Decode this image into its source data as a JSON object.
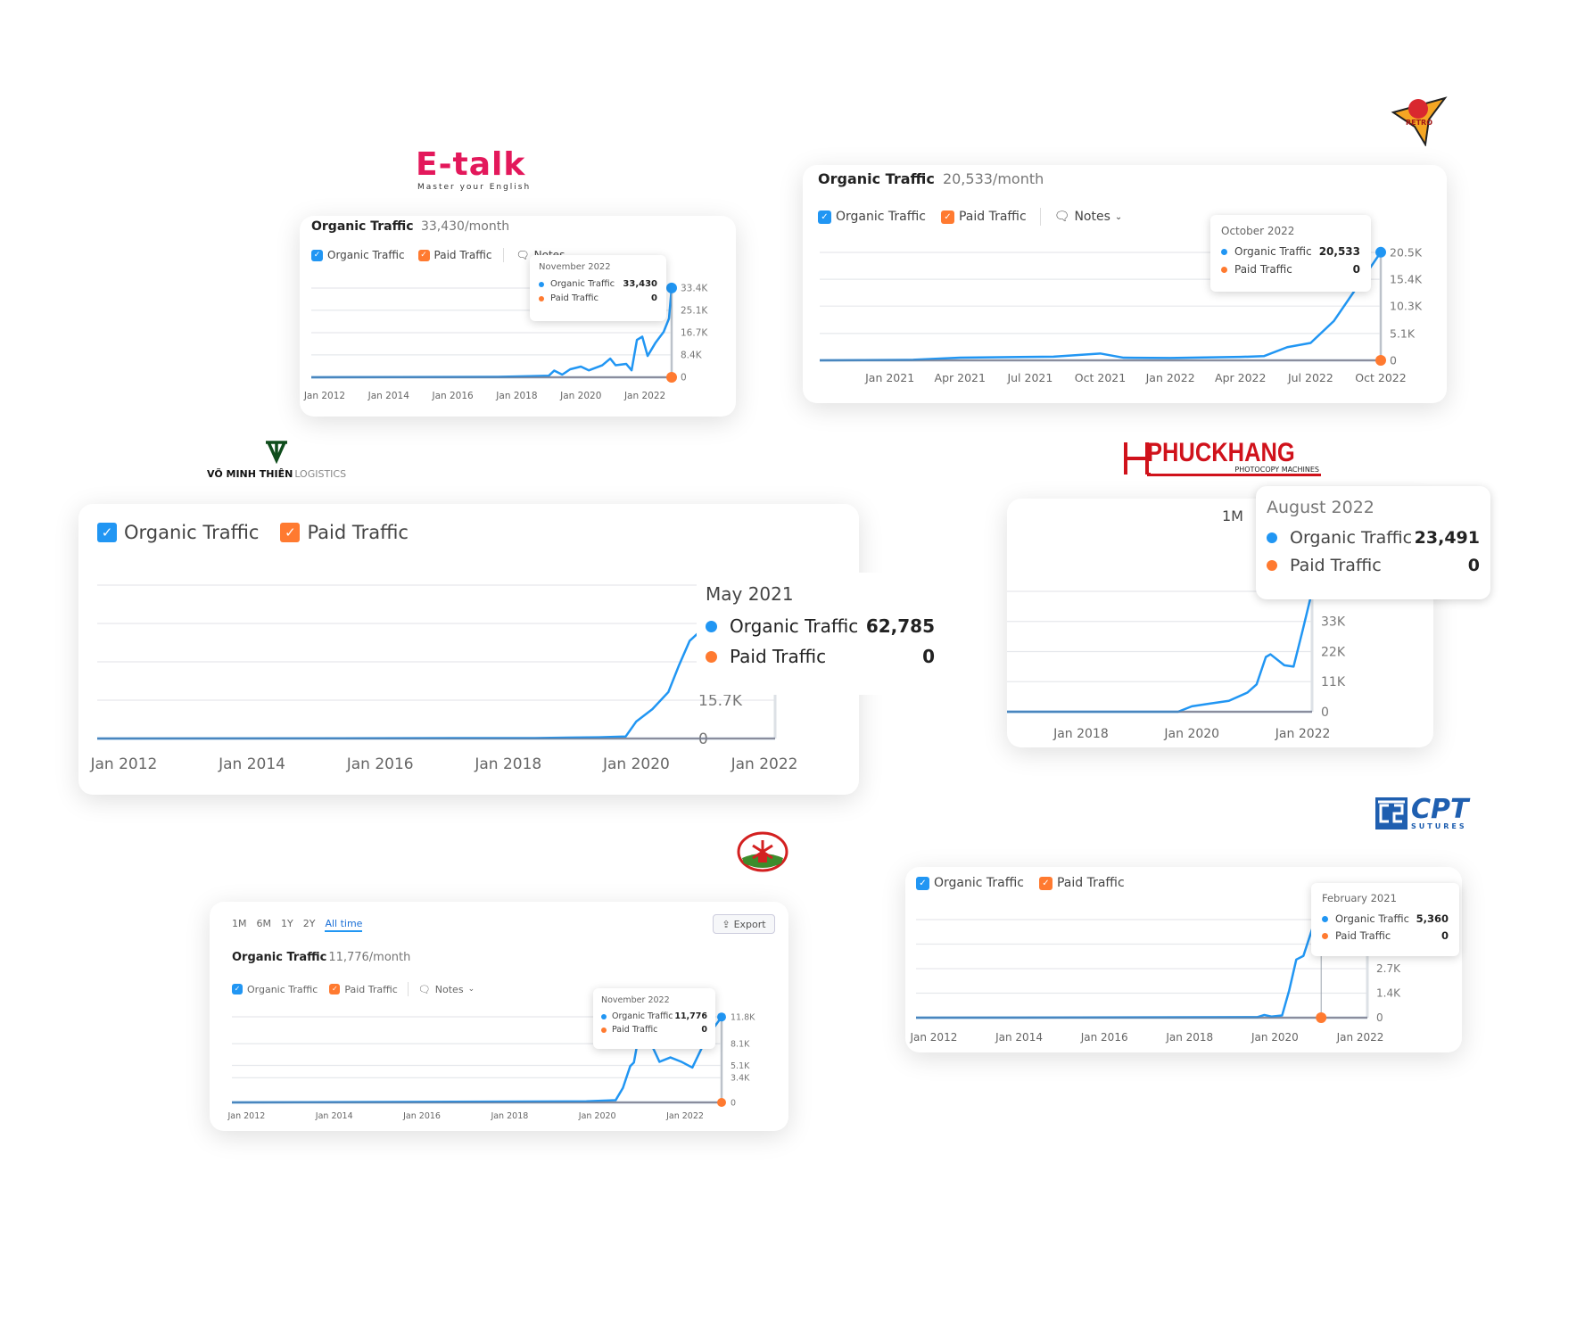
{
  "logos": {
    "etalk": {
      "name": "E-talk",
      "tagline": "Master your English"
    },
    "saigon_retro": {
      "name": "SAIGON RETRO"
    },
    "vmt": {
      "name": "VÕ MINH THIÊN",
      "suffix": "LOGISTICS"
    },
    "phuckhang": {
      "name": "PHUCKHANG",
      "tagline": "PHOTOCOPY MACHINES"
    },
    "windmill": {
      "name": "windmill-logo"
    },
    "cpt": {
      "name": "CPT",
      "tagline": "SUTURES"
    }
  },
  "colors": {
    "organic": "#2196f3",
    "paid": "#ff7a30",
    "grid": "#e6e8ec"
  },
  "legend": {
    "organic": "Organic Traffic",
    "paid": "Paid Traffic",
    "notes": "Notes",
    "check": "✓"
  },
  "cards": [
    {
      "title": "Organic Traffic",
      "subtitle": "33,430/month",
      "tooltip": {
        "date": "November 2022",
        "organic": "33,430",
        "paid": "0"
      }
    },
    {
      "title": "Organic Traffic",
      "subtitle": "20,533/month",
      "tooltip": {
        "date": "October 2022",
        "organic": "20,533",
        "paid": "0"
      }
    },
    {
      "tooltip": {
        "date": "May 2021",
        "organic": "62,785",
        "paid": "0"
      }
    },
    {
      "range": "1M",
      "tooltip": {
        "date": "August 2022",
        "organic": "23,491",
        "paid": "0"
      }
    },
    {
      "title": "Organic Traffic",
      "subtitle": "11,776/month",
      "ranges": [
        "1M",
        "6M",
        "1Y",
        "2Y",
        "All time"
      ],
      "active_range": "All time",
      "export": "Export",
      "tooltip": {
        "date": "November 2022",
        "organic": "11,776",
        "paid": "0"
      }
    },
    {
      "tooltip": {
        "date": "February 2021",
        "organic": "5,360",
        "paid": "0"
      }
    }
  ],
  "chart_data": [
    {
      "type": "line",
      "x_range": [
        "2011-08",
        "2022-11"
      ],
      "ylim": [
        0,
        33400
      ],
      "x_ticks": [
        {
          "label": "Jan 2012",
          "date": "2012-01"
        },
        {
          "label": "Jan 2014",
          "date": "2014-01"
        },
        {
          "label": "Jan 2016",
          "date": "2016-01"
        },
        {
          "label": "Jan 2018",
          "date": "2018-01"
        },
        {
          "label": "Jan 2020",
          "date": "2020-01"
        },
        {
          "label": "Jan 2022",
          "date": "2022-01"
        }
      ],
      "y_ticks": [
        {
          "label": "0",
          "value": 0
        },
        {
          "label": "8.4K",
          "value": 8400
        },
        {
          "label": "16.7K",
          "value": 16700
        },
        {
          "label": "25.1K",
          "value": 25100
        },
        {
          "label": "33.4K",
          "value": 33400
        }
      ],
      "hover": "2022-11",
      "series": [
        {
          "name": "Organic Traffic",
          "points": [
            [
              "2011-08",
              0
            ],
            [
              "2017-06",
              150
            ],
            [
              "2018-06",
              400
            ],
            [
              "2019-01",
              600
            ],
            [
              "2019-03",
              2500
            ],
            [
              "2019-06",
              1000
            ],
            [
              "2019-09",
              3000
            ],
            [
              "2020-01",
              4000
            ],
            [
              "2020-04",
              2600
            ],
            [
              "2020-09",
              4500
            ],
            [
              "2020-12",
              7000
            ],
            [
              "2021-02",
              4500
            ],
            [
              "2021-06",
              5000
            ],
            [
              "2021-08",
              2600
            ],
            [
              "2021-10",
              14000
            ],
            [
              "2021-12",
              15200
            ],
            [
              "2022-02",
              8000
            ],
            [
              "2022-05",
              13000
            ],
            [
              "2022-08",
              17000
            ],
            [
              "2022-10",
              22000
            ],
            [
              "2022-11",
              33430
            ]
          ]
        },
        {
          "name": "Paid Traffic",
          "points": [
            [
              "2011-08",
              0
            ],
            [
              "2022-11",
              0
            ]
          ]
        }
      ]
    },
    {
      "type": "line",
      "x_range": [
        "2020-10",
        "2022-10"
      ],
      "ylim": [
        0,
        20500
      ],
      "x_ticks": [
        {
          "label": "Jan 2021",
          "date": "2021-01"
        },
        {
          "label": "Apr 2021",
          "date": "2021-04"
        },
        {
          "label": "Jul 2021",
          "date": "2021-07"
        },
        {
          "label": "Oct 2021",
          "date": "2021-10"
        },
        {
          "label": "Jan 2022",
          "date": "2022-01"
        },
        {
          "label": "Apr 2022",
          "date": "2022-04"
        },
        {
          "label": "Jul 2022",
          "date": "2022-07"
        },
        {
          "label": "Oct 2022",
          "date": "2022-10"
        }
      ],
      "y_ticks": [
        {
          "label": "0",
          "value": 0
        },
        {
          "label": "5.1K",
          "value": 5100
        },
        {
          "label": "10.3K",
          "value": 10300
        },
        {
          "label": "15.4K",
          "value": 15400
        },
        {
          "label": "20.5K",
          "value": 20500
        }
      ],
      "hover": "2022-10",
      "series": [
        {
          "name": "Organic Traffic",
          "points": [
            [
              "2020-10",
              0
            ],
            [
              "2021-02",
              100
            ],
            [
              "2021-04",
              500
            ],
            [
              "2021-08",
              700
            ],
            [
              "2021-10",
              1300
            ],
            [
              "2021-11",
              500
            ],
            [
              "2022-01",
              450
            ],
            [
              "2022-04",
              650
            ],
            [
              "2022-05",
              800
            ],
            [
              "2022-06",
              2500
            ],
            [
              "2022-07",
              3300
            ],
            [
              "2022-08",
              7500
            ],
            [
              "2022-09",
              14000
            ],
            [
              "2022-10",
              20533
            ]
          ]
        },
        {
          "name": "Paid Traffic",
          "points": [
            [
              "2020-10",
              0
            ],
            [
              "2022-10",
              0
            ]
          ]
        }
      ]
    },
    {
      "type": "line",
      "x_range": [
        "2011-08",
        "2022-03"
      ],
      "ylim": [
        0,
        62785
      ],
      "x_ticks": [
        {
          "label": "Jan 2012",
          "date": "2012-01"
        },
        {
          "label": "Jan 2014",
          "date": "2014-01"
        },
        {
          "label": "Jan 2016",
          "date": "2016-01"
        },
        {
          "label": "Jan 2018",
          "date": "2018-01"
        },
        {
          "label": "Jan 2020",
          "date": "2020-01"
        },
        {
          "label": "Jan 2022",
          "date": "2022-01"
        }
      ],
      "y_ticks": [
        {
          "label": "0",
          "value": 0
        },
        {
          "label": "15.7K",
          "value": 15700
        },
        {
          "label": "",
          "value": 31400
        },
        {
          "label": "",
          "value": 47100
        },
        {
          "label": "",
          "value": 62785
        }
      ],
      "hover": "2021-05",
      "series": [
        {
          "name": "Organic Traffic",
          "points": [
            [
              "2011-08",
              0
            ],
            [
              "2018-06",
              200
            ],
            [
              "2019-06",
              500
            ],
            [
              "2019-11",
              800
            ],
            [
              "2020-01",
              7000
            ],
            [
              "2020-04",
              12000
            ],
            [
              "2020-07",
              19000
            ],
            [
              "2020-09",
              30000
            ],
            [
              "2020-11",
              40000
            ],
            [
              "2021-01",
              44000
            ],
            [
              "2021-02",
              34000
            ],
            [
              "2021-03",
              47000
            ],
            [
              "2021-04",
              40000
            ],
            [
              "2021-05",
              62785
            ]
          ]
        },
        {
          "name": "Paid Traffic",
          "points": [
            [
              "2011-08",
              0
            ],
            [
              "2022-03",
              0
            ]
          ]
        }
      ]
    },
    {
      "type": "line",
      "x_range": [
        "2016-09",
        "2022-03"
      ],
      "ylim": [
        0,
        44000
      ],
      "x_ticks": [
        {
          "label": "Jan 2018",
          "date": "2018-01"
        },
        {
          "label": "Jan 2020",
          "date": "2020-01"
        },
        {
          "label": "Jan 2022",
          "date": "2022-01"
        }
      ],
      "y_ticks": [
        {
          "label": "0",
          "value": 0
        },
        {
          "label": "11K",
          "value": 11000
        },
        {
          "label": "22K",
          "value": 22000
        },
        {
          "label": "33K",
          "value": 33000
        },
        {
          "label": "",
          "value": 44000
        }
      ],
      "hover": null,
      "series": [
        {
          "name": "Organic Traffic",
          "points": [
            [
              "2016-09",
              0
            ],
            [
              "2019-10",
              0
            ],
            [
              "2020-01",
              2000
            ],
            [
              "2020-05",
              3000
            ],
            [
              "2020-09",
              4000
            ],
            [
              "2021-01",
              7000
            ],
            [
              "2021-03",
              10000
            ],
            [
              "2021-05",
              20000
            ],
            [
              "2021-06",
              21000
            ],
            [
              "2021-09",
              17000
            ],
            [
              "2021-11",
              16500
            ],
            [
              "2022-01",
              30000
            ],
            [
              "2022-03",
              44000
            ]
          ]
        },
        {
          "name": "Paid Traffic",
          "points": [
            [
              "2016-09",
              0
            ],
            [
              "2022-03",
              0
            ]
          ]
        }
      ]
    },
    {
      "type": "line",
      "x_range": [
        "2011-09",
        "2022-11"
      ],
      "ylim": [
        0,
        11800
      ],
      "x_ticks": [
        {
          "label": "Jan 2012",
          "date": "2012-01"
        },
        {
          "label": "Jan 2014",
          "date": "2014-01"
        },
        {
          "label": "Jan 2016",
          "date": "2016-01"
        },
        {
          "label": "Jan 2018",
          "date": "2018-01"
        },
        {
          "label": "Jan 2020",
          "date": "2020-01"
        },
        {
          "label": "Jan 2022",
          "date": "2022-01"
        }
      ],
      "y_ticks": [
        {
          "label": "0",
          "value": 0
        },
        {
          "label": "3.4K",
          "value": 3400
        },
        {
          "label": "5.1K",
          "value": 5100
        },
        {
          "label": "8.1K",
          "value": 8100
        },
        {
          "label": "11.8K",
          "value": 11800
        }
      ],
      "hover": "2022-11",
      "series": [
        {
          "name": "Organic Traffic",
          "points": [
            [
              "2011-09",
              0
            ],
            [
              "2019-10",
              150
            ],
            [
              "2020-06",
              300
            ],
            [
              "2020-08",
              2000
            ],
            [
              "2020-10",
              5000
            ],
            [
              "2020-11",
              5500
            ],
            [
              "2021-01",
              11000
            ],
            [
              "2021-06",
              5600
            ],
            [
              "2021-09",
              6200
            ],
            [
              "2021-12",
              5600
            ],
            [
              "2022-03",
              4800
            ],
            [
              "2022-07",
              9000
            ],
            [
              "2022-11",
              11776
            ]
          ]
        },
        {
          "name": "Paid Traffic",
          "points": [
            [
              "2011-09",
              0
            ],
            [
              "2022-11",
              0
            ]
          ]
        }
      ]
    },
    {
      "type": "line",
      "x_range": [
        "2011-08",
        "2022-03"
      ],
      "ylim": [
        0,
        5400
      ],
      "x_ticks": [
        {
          "label": "Jan 2012",
          "date": "2012-01"
        },
        {
          "label": "Jan 2014",
          "date": "2014-01"
        },
        {
          "label": "Jan 2016",
          "date": "2016-01"
        },
        {
          "label": "Jan 2018",
          "date": "2018-01"
        },
        {
          "label": "Jan 2020",
          "date": "2020-01"
        },
        {
          "label": "Jan 2022",
          "date": "2022-01"
        }
      ],
      "y_ticks": [
        {
          "label": "0",
          "value": 0
        },
        {
          "label": "1.4K",
          "value": 1350
        },
        {
          "label": "2.7K",
          "value": 2700
        },
        {
          "label": "",
          "value": 4050
        },
        {
          "label": "",
          "value": 5400
        }
      ],
      "hover": "2021-02",
      "series": [
        {
          "name": "Organic Traffic",
          "points": [
            [
              "2011-08",
              0
            ],
            [
              "2019-08",
              30
            ],
            [
              "2019-10",
              150
            ],
            [
              "2019-12",
              60
            ],
            [
              "2020-03",
              120
            ],
            [
              "2020-05",
              1500
            ],
            [
              "2020-07",
              3200
            ],
            [
              "2020-09",
              3400
            ],
            [
              "2020-12",
              5200
            ],
            [
              "2021-02",
              5360
            ],
            [
              "2021-03",
              4600
            ],
            [
              "2021-04",
              5000
            ]
          ]
        },
        {
          "name": "Paid Traffic",
          "points": [
            [
              "2011-08",
              0
            ],
            [
              "2022-03",
              0
            ]
          ]
        }
      ]
    }
  ]
}
